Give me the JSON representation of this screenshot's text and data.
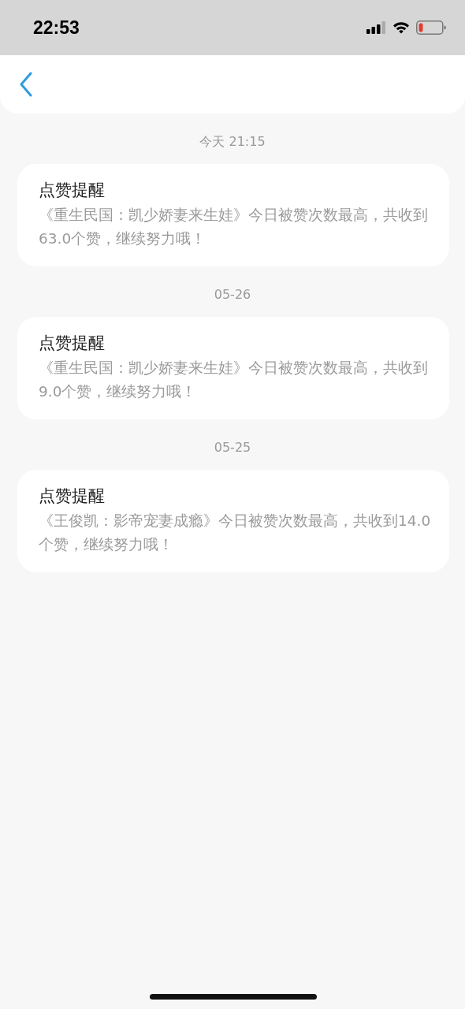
{
  "status_bar": {
    "time": "22:53"
  },
  "notifications": [
    {
      "date": "今天 21:15",
      "title": "点赞提醒",
      "body": "《重生民国：凯少娇妻来生娃》今日被赞次数最高，共收到63.0个赞，继续努力哦！"
    },
    {
      "date": "05-26",
      "title": "点赞提醒",
      "body": "《重生民国：凯少娇妻来生娃》今日被赞次数最高，共收到9.0个赞，继续努力哦！"
    },
    {
      "date": "05-25",
      "title": "点赞提醒",
      "body": "《王俊凯：影帝宠妻成瘾》今日被赞次数最高，共收到14.0个赞，继续努力哦！"
    }
  ]
}
